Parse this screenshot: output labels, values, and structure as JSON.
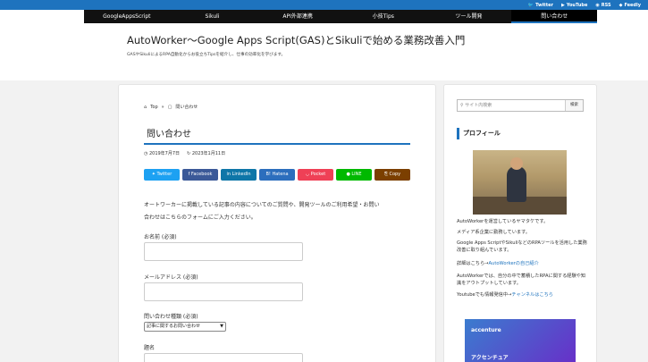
{
  "topbar": {
    "social": [
      {
        "icon": "twitter-icon",
        "glyph": "🐦",
        "label": "Twitter"
      },
      {
        "icon": "youtube-icon",
        "glyph": "▶",
        "label": "YouTube"
      },
      {
        "icon": "rss-icon",
        "glyph": "◉",
        "label": "RSS"
      },
      {
        "icon": "feedly-icon",
        "glyph": "◆",
        "label": "Feedly"
      }
    ]
  },
  "nav": {
    "items": [
      "GoogleAppsScript",
      "Sikuli",
      "API外部連携",
      "小技Tips",
      "ツール開発",
      "問い合わせ"
    ]
  },
  "header": {
    "title": "AutoWorker〜Google Apps Script(GAS)とSikuliで始める業務改善入門",
    "description": "GASやSikuliによるRPA自動化からお役立ちTipsを紹介し、仕事の効率化を学びます。"
  },
  "article": {
    "breadcrumb_home": "Top",
    "breadcrumb_current": "問い合わせ",
    "title": "問い合わせ",
    "published": "2019年7月7日",
    "updated": "2023年1月11日",
    "share": [
      {
        "label": "Twitter",
        "color": "#1da1f2"
      },
      {
        "label": "Facebook",
        "color": "#3b5998"
      },
      {
        "label": "LinkedIn",
        "color": "#0e76a8"
      },
      {
        "label": "Hatena",
        "color": "#2c6ebd"
      },
      {
        "label": "Pocket",
        "color": "#ef4056"
      },
      {
        "label": "LINE",
        "color": "#00b900"
      },
      {
        "label": "Copy",
        "color": "#7b3f00"
      }
    ],
    "intro_line1": "オートワーカーに掲載している記事の内容についてのご質問や、開発ツールのご利用希望・お問い",
    "intro_line2": "合わせはこちらのフォームにご入力ください。",
    "form": {
      "name_label": "お名前 (必須)",
      "email_label": "メールアドレス (必須)",
      "type_label": "問い合わせ種類 (必須)",
      "type_value": "記事に関するお問い合わせ",
      "subject_label": "題名"
    }
  },
  "sidebar": {
    "search_placeholder": "サイト内検索",
    "search_button": "検索",
    "profile_heading": "プロフィール",
    "p1": "AutoWorkerを運営しているヤマタケです。",
    "p2": "メディア系企業に勤務しています。",
    "p3": "Google Apps ScriptやSikuliなどのRPAツールを活用した業務改善に取り組んでいます。",
    "p4_prefix": "詳細はこちら→",
    "p4_link": "AutoWorkerの自己紹介",
    "p5": "AutoWorkerでは、自分の中で蓄積したRPAに関する経験や知識をアウトプットしています。",
    "p6_prefix": "Youtubeでも情報発信中→",
    "p6_link": "チャンネルはこちら",
    "ad_brand": "accenture",
    "ad_kana": "アクセンチュア"
  }
}
